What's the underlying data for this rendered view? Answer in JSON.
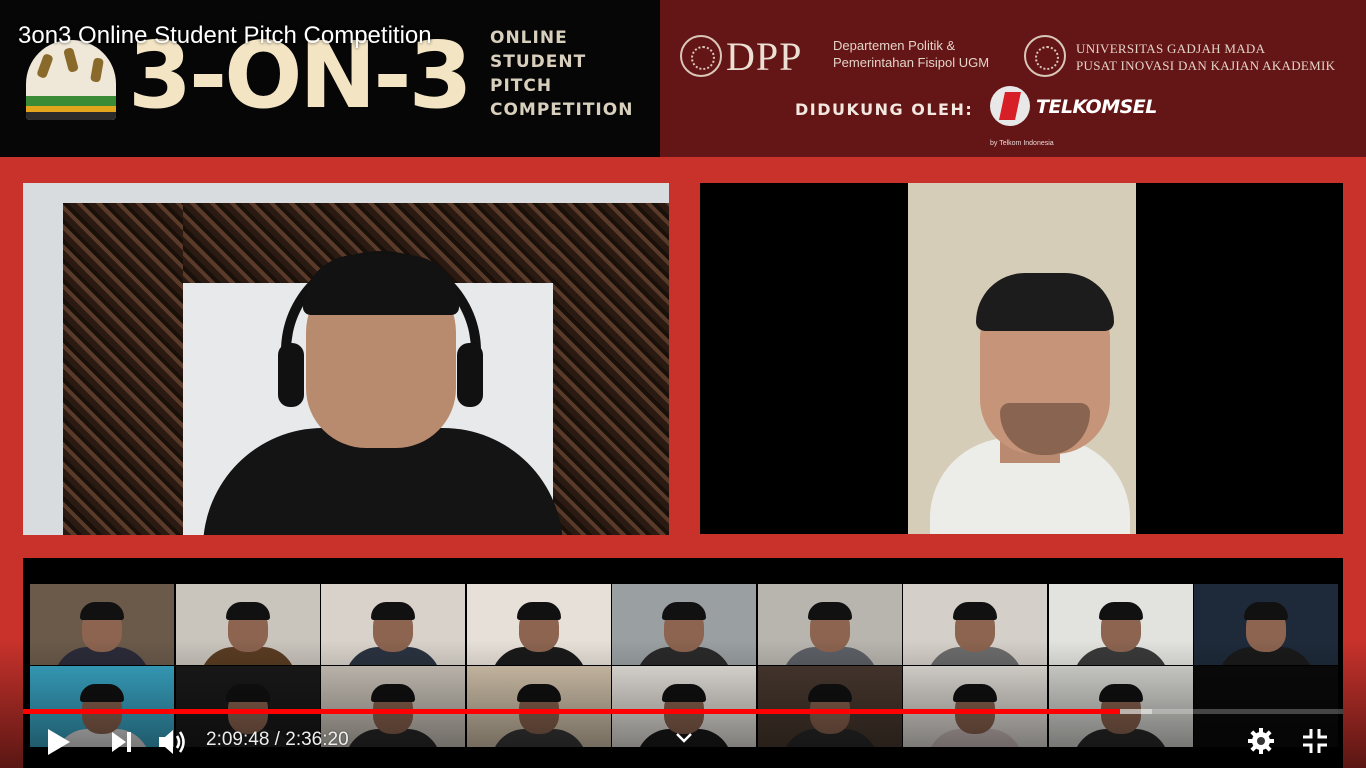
{
  "video": {
    "title": "3on3 Online Student Pitch Competition",
    "banner": {
      "logo_text": "3-ON-3",
      "logo_sub": [
        "ONLINE",
        "STUDENT",
        "PITCH",
        "COMPETITION"
      ],
      "dpp_word": "DPP",
      "dpp_line1": "Departemen Politik &",
      "dpp_line2": "Pemerintahan Fisipol UGM",
      "ugm_line1": "UNIVERSITAS GADJAH MADA",
      "ugm_line2": "PUSAT INOVASI DAN KAJIAN AKADEMIK",
      "support_label": "DIDUKUNG OLEH:",
      "sponsor": "TELKOMSEL",
      "sponsor_sub": "by Telkom Indonesia"
    }
  },
  "player": {
    "current_time": "2:09:48",
    "separator": " / ",
    "duration": "2:36:20",
    "progress_fraction": 0.831,
    "buffer_fraction": 0.855,
    "progress_color": "#ff0000",
    "icons": {
      "play": "play-icon",
      "next": "next-icon",
      "volume": "volume-icon",
      "chevron": "chevron-down-icon",
      "settings": "gear-icon",
      "fullscreen_exit": "exit-fullscreen-icon"
    }
  },
  "gallery": {
    "participants": [
      {
        "bg": "#6b5a4a",
        "shirt": "#2c2c3a"
      },
      {
        "bg": "#c9c4bc",
        "shirt": "#5a3c22"
      },
      {
        "bg": "#d8d2ca",
        "shirt": "#2a3340"
      },
      {
        "bg": "#e6e0d8",
        "shirt": "#1a1a1a"
      },
      {
        "bg": "#9aa0a2",
        "shirt": "#2a2a2a"
      },
      {
        "bg": "#b8b4ae",
        "shirt": "#5d6066"
      },
      {
        "bg": "#d4cfc8",
        "shirt": "#6c6c6c"
      },
      {
        "bg": "#e2e2de",
        "shirt": "#3a3a3a"
      },
      {
        "bg": "#1e2a3a",
        "shirt": "#1a1a1a"
      },
      {
        "bg": "#3aa8c8",
        "shirt": "#e0e0e0"
      },
      {
        "bg": "#1a1a1a",
        "shirt": "#222222"
      },
      {
        "bg": "#cfc8be",
        "shirt": "#2a2a2a"
      },
      {
        "bg": "#d8c8b0",
        "shirt": "#3a3a3a"
      },
      {
        "bg": "#ece8e2",
        "shirt": "#1a1a1a"
      },
      {
        "bg": "#4a3a30",
        "shirt": "#2a2a2a"
      },
      {
        "bg": "#e6e2dc",
        "shirt": "#d0c0c0"
      },
      {
        "bg": "#dcdcd8",
        "shirt": "#2a2a2a"
      },
      {
        "bg": "#0a0a0a",
        "shirt": "#0a0a0a"
      }
    ]
  }
}
